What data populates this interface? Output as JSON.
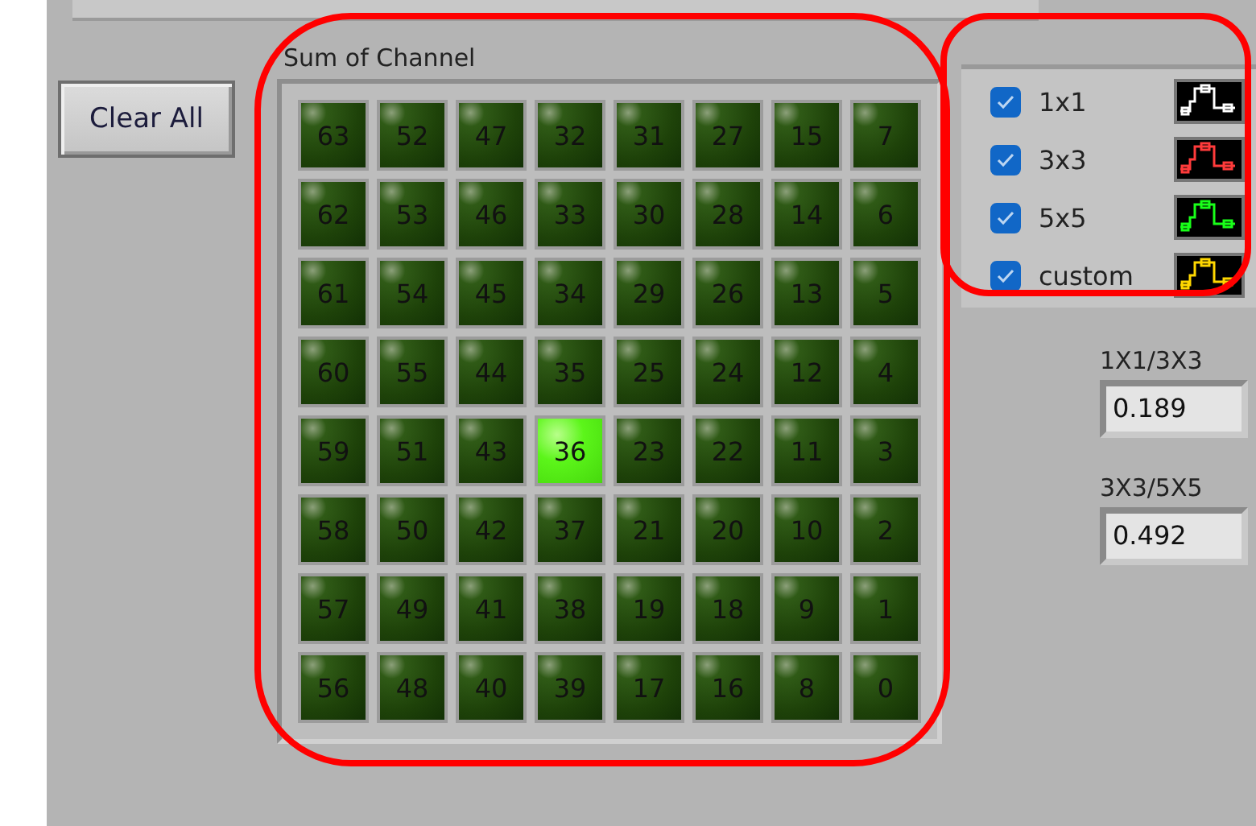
{
  "clear_button": {
    "label": "Clear All"
  },
  "channel_grid": {
    "title": "Sum of Channel",
    "rows": [
      [
        {
          "label": "63",
          "on": false
        },
        {
          "label": "52",
          "on": false
        },
        {
          "label": "47",
          "on": false
        },
        {
          "label": "32",
          "on": false
        },
        {
          "label": "31",
          "on": false
        },
        {
          "label": "27",
          "on": false
        },
        {
          "label": "15",
          "on": false
        },
        {
          "label": "7",
          "on": false
        }
      ],
      [
        {
          "label": "62",
          "on": false
        },
        {
          "label": "53",
          "on": false
        },
        {
          "label": "46",
          "on": false
        },
        {
          "label": "33",
          "on": false
        },
        {
          "label": "30",
          "on": false
        },
        {
          "label": "28",
          "on": false
        },
        {
          "label": "14",
          "on": false
        },
        {
          "label": "6",
          "on": false
        }
      ],
      [
        {
          "label": "61",
          "on": false
        },
        {
          "label": "54",
          "on": false
        },
        {
          "label": "45",
          "on": false
        },
        {
          "label": "34",
          "on": false
        },
        {
          "label": "29",
          "on": false
        },
        {
          "label": "26",
          "on": false
        },
        {
          "label": "13",
          "on": false
        },
        {
          "label": "5",
          "on": false
        }
      ],
      [
        {
          "label": "60",
          "on": false
        },
        {
          "label": "55",
          "on": false
        },
        {
          "label": "44",
          "on": false
        },
        {
          "label": "35",
          "on": false
        },
        {
          "label": "25",
          "on": false
        },
        {
          "label": "24",
          "on": false
        },
        {
          "label": "12",
          "on": false
        },
        {
          "label": "4",
          "on": false
        }
      ],
      [
        {
          "label": "59",
          "on": false
        },
        {
          "label": "51",
          "on": false
        },
        {
          "label": "43",
          "on": false
        },
        {
          "label": "36",
          "on": true
        },
        {
          "label": "23",
          "on": false
        },
        {
          "label": "22",
          "on": false
        },
        {
          "label": "11",
          "on": false
        },
        {
          "label": "3",
          "on": false
        }
      ],
      [
        {
          "label": "58",
          "on": false
        },
        {
          "label": "50",
          "on": false
        },
        {
          "label": "42",
          "on": false
        },
        {
          "label": "37",
          "on": false
        },
        {
          "label": "21",
          "on": false
        },
        {
          "label": "20",
          "on": false
        },
        {
          "label": "10",
          "on": false
        },
        {
          "label": "2",
          "on": false
        }
      ],
      [
        {
          "label": "57",
          "on": false
        },
        {
          "label": "49",
          "on": false
        },
        {
          "label": "41",
          "on": false
        },
        {
          "label": "38",
          "on": false
        },
        {
          "label": "19",
          "on": false
        },
        {
          "label": "18",
          "on": false
        },
        {
          "label": "9",
          "on": false
        },
        {
          "label": "1",
          "on": false
        }
      ],
      [
        {
          "label": "56",
          "on": false
        },
        {
          "label": "48",
          "on": false
        },
        {
          "label": "40",
          "on": false
        },
        {
          "label": "39",
          "on": false
        },
        {
          "label": "17",
          "on": false
        },
        {
          "label": "16",
          "on": false
        },
        {
          "label": "8",
          "on": false
        },
        {
          "label": "0",
          "on": false
        }
      ]
    ]
  },
  "legend": [
    {
      "label": "1x1",
      "checked": true,
      "color": "#ffffff"
    },
    {
      "label": "3x3",
      "checked": true,
      "color": "#ff3b3b"
    },
    {
      "label": "5x5",
      "checked": true,
      "color": "#19ff19"
    },
    {
      "label": "custom",
      "checked": true,
      "color": "#ffd700"
    }
  ],
  "ratios": [
    {
      "label": "1X1/3X3",
      "value": "0.189"
    },
    {
      "label": "3X3/5X5",
      "value": "0.492"
    }
  ]
}
